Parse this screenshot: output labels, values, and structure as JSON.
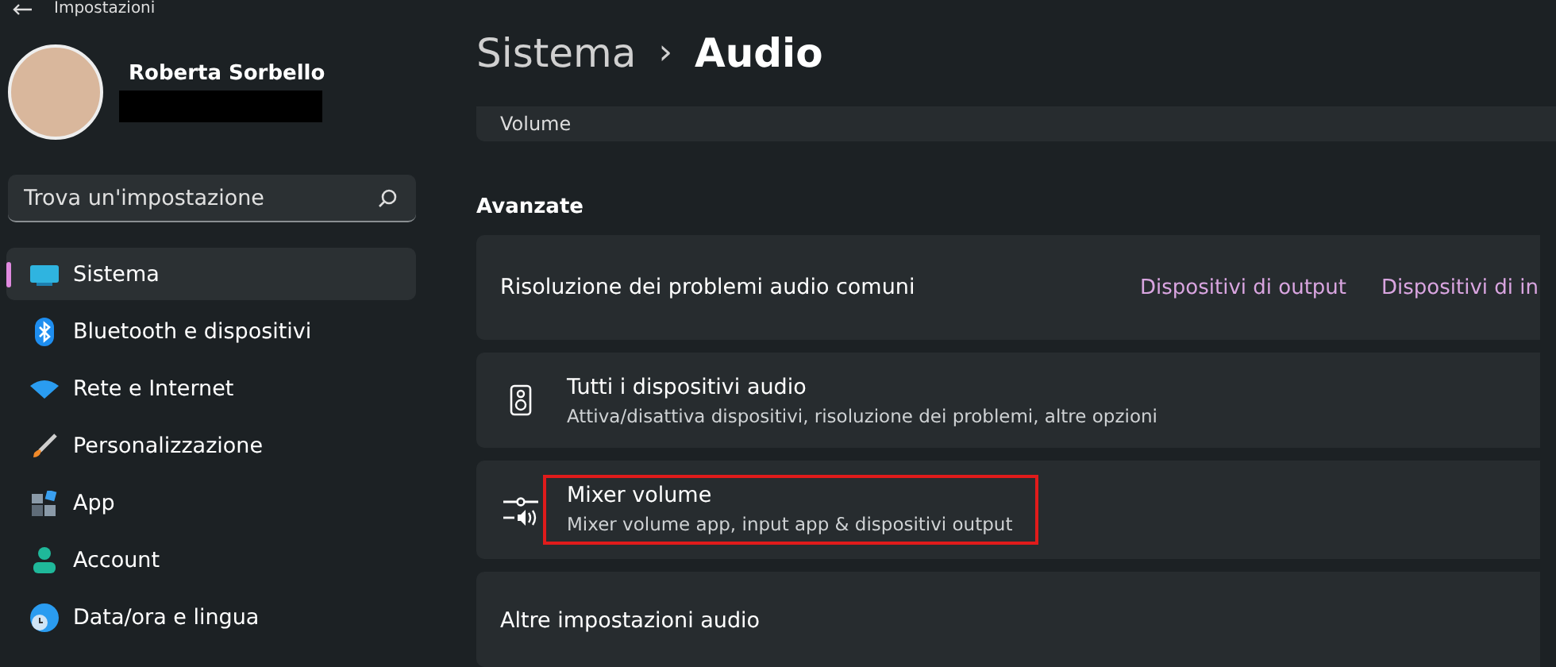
{
  "window": {
    "title": "Impostazioni"
  },
  "user": {
    "name": "Roberta Sorbello",
    "email_redacted": true
  },
  "search": {
    "placeholder": "Trova un'impostazione"
  },
  "sidebar": {
    "items": [
      {
        "kind": "monitor",
        "label": "Sistema",
        "selected": true
      },
      {
        "kind": "bluetooth",
        "label": "Bluetooth e dispositivi",
        "selected": false
      },
      {
        "kind": "wifi",
        "label": "Rete e Internet",
        "selected": false
      },
      {
        "kind": "brush",
        "label": "Personalizzazione",
        "selected": false
      },
      {
        "kind": "apps",
        "label": "App",
        "selected": false
      },
      {
        "kind": "person",
        "label": "Account",
        "selected": false
      },
      {
        "kind": "clock",
        "label": "Data/ora e lingua",
        "selected": false
      }
    ]
  },
  "breadcrumb": {
    "parent": "Sistema",
    "separator": "›",
    "current": "Audio"
  },
  "volume_card": {
    "label": "Volume"
  },
  "section": {
    "title": "Avanzate"
  },
  "cards": [
    {
      "kind": "links",
      "title": "Risoluzione dei problemi audio comuni",
      "links": [
        "Dispositivi di output",
        "Dispositivi di in"
      ]
    },
    {
      "kind": "devices",
      "title": "Tutti i dispositivi audio",
      "subtitle": "Attiva/disattiva dispositivi, risoluzione dei problemi, altre opzioni",
      "highlighted": false
    },
    {
      "kind": "mixer",
      "title": "Mixer volume",
      "subtitle": "Mixer volume app, input app & dispositivi output",
      "highlighted": true
    },
    {
      "kind": "plain",
      "title": "Altre impostazioni audio"
    }
  ]
}
